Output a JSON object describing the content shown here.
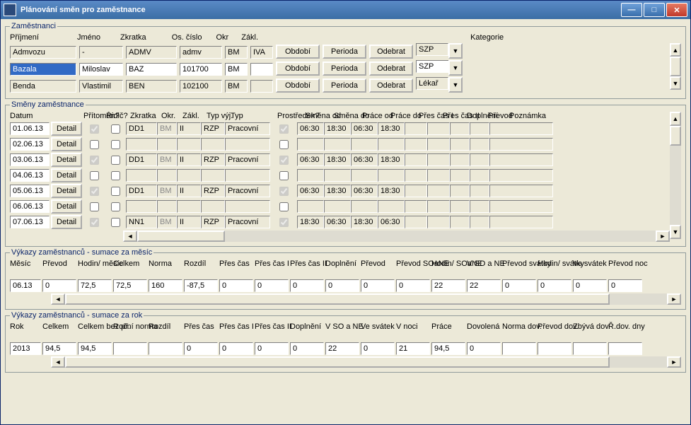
{
  "window": {
    "title": "Plánování směn pro zaměstnance"
  },
  "employees": {
    "legend": "Zaměstnanci",
    "headers": {
      "prijmeni": "Příjmení",
      "jmeno": "Jméno",
      "zkratka": "Zkratka",
      "oscislo": "Os. číslo",
      "okr": "Okr",
      "zakl": "Zákl.",
      "kategorie": "Kategorie"
    },
    "buttons": {
      "obdobi": "Období",
      "perioda": "Perioda",
      "odebrat": "Odebrat"
    },
    "rows": [
      {
        "prijmeni": "Admvozu",
        "jmeno": "-",
        "zkratka": "ADMV",
        "oscislo": "admv",
        "okr": "BM",
        "zakl": "IVA",
        "kategorie": "SZP"
      },
      {
        "prijmeni": "Bazala",
        "jmeno": "Miloslav",
        "zkratka": "BAZ",
        "oscislo": "101700",
        "okr": "BM",
        "zakl": "",
        "kategorie": "SZP"
      },
      {
        "prijmeni": "Benda",
        "jmeno": "Vlastimil",
        "zkratka": "BEN",
        "oscislo": "102100",
        "okr": "BM",
        "zakl": "",
        "kategorie": "Lékař"
      }
    ]
  },
  "shifts": {
    "legend": "Směny zaměstnance",
    "headers": {
      "datum": "Datum",
      "detail": "Detail",
      "prito_men": "Přítomen?",
      "ridic": "Řidič?",
      "zkratka": "Zkratka",
      "okr": "Okr.",
      "zakl": "Zákl.",
      "typvyj": "Typ výj.",
      "typ": "Typ",
      "prostre_dek": "Prostředek?",
      "smena_od": "Směna od",
      "smena_do": "Směna do",
      "prace_od": "Práce od",
      "prace_do": "Práce do",
      "pres_cas1": "Přes čas I",
      "pres_cas2": "Přes čas II",
      "dopl_neni": "Doplnění",
      "pre_vod": "Převod",
      "poznamka": "Poznámka"
    },
    "btn_detail": "Detail",
    "rows": [
      {
        "datum": "01.06.13",
        "p": true,
        "r": false,
        "zk": "DD1",
        "okr": "BM",
        "zakl": "II",
        "tv": "RZP",
        "typ": "Pracovní",
        "ps": true,
        "so": "06:30",
        "sd": "18:30",
        "po": "06:30",
        "pd": "18:30"
      },
      {
        "datum": "02.06.13",
        "p": false,
        "r": false,
        "zk": "",
        "okr": "",
        "zakl": "",
        "tv": "",
        "typ": "",
        "ps": false,
        "so": "",
        "sd": "",
        "po": "",
        "pd": ""
      },
      {
        "datum": "03.06.13",
        "p": true,
        "r": false,
        "zk": "DD1",
        "okr": "BM",
        "zakl": "II",
        "tv": "RZP",
        "typ": "Pracovní",
        "ps": true,
        "so": "06:30",
        "sd": "18:30",
        "po": "06:30",
        "pd": "18:30"
      },
      {
        "datum": "04.06.13",
        "p": false,
        "r": false,
        "zk": "",
        "okr": "",
        "zakl": "",
        "tv": "",
        "typ": "",
        "ps": false,
        "so": "",
        "sd": "",
        "po": "",
        "pd": ""
      },
      {
        "datum": "05.06.13",
        "p": true,
        "r": false,
        "zk": "DD1",
        "okr": "BM",
        "zakl": "II",
        "tv": "RZP",
        "typ": "Pracovní",
        "ps": true,
        "so": "06:30",
        "sd": "18:30",
        "po": "06:30",
        "pd": "18:30"
      },
      {
        "datum": "06.06.13",
        "p": false,
        "r": false,
        "zk": "",
        "okr": "",
        "zakl": "",
        "tv": "",
        "typ": "",
        "ps": false,
        "so": "",
        "sd": "",
        "po": "",
        "pd": ""
      },
      {
        "datum": "07.06.13",
        "p": true,
        "r": false,
        "zk": "NN1",
        "okr": "BM",
        "zakl": "II",
        "tv": "RZP",
        "typ": "Pracovní",
        "ps": true,
        "so": "18:30",
        "sd": "06:30",
        "po": "18:30",
        "pd": "06:30"
      }
    ]
  },
  "monthly": {
    "legend": "Výkazy zaměstnanců - sumace za měsíc",
    "labels": [
      "Měsíc",
      "Převod",
      "Hodin/ měsíc",
      "Celkem",
      "Norma",
      "Rozdíl",
      "Přes čas",
      "Přes čas I",
      "Přes čas II",
      "Doplnění",
      "Převod",
      "Převod SOaNE",
      "Hodin/ SOaNE",
      "V SO a NE",
      "Převod svátky",
      "Hodin/ svátky",
      "Ve svátek",
      "Převod noc"
    ],
    "values": [
      "06.13",
      "0",
      "72,5",
      "72,5",
      "160",
      "-87,5",
      "0",
      "0",
      "0",
      "0",
      "0",
      "0",
      "22",
      "22",
      "0",
      "0",
      "0",
      "0"
    ]
  },
  "yearly": {
    "legend": "Výkazy zaměstnanců - sumace za rok",
    "labels": [
      "Rok",
      "Celkem",
      "Celkem bez př.",
      "Roční norma",
      "Rozdíl",
      "Přes čas",
      "Přes čas I",
      "Přes čas II",
      "Doplnění",
      "V SO a NE",
      "Ve svátek",
      "V noci",
      "Práce",
      "Dovolená",
      "Norma dov.",
      "Převod dov.",
      "Zbývá dov.",
      "Ř.dov. dny"
    ],
    "values": [
      "2013",
      "94,5",
      "94,5",
      "",
      "",
      "0",
      "0",
      "0",
      "0",
      "22",
      "0",
      "21",
      "94,5",
      "0",
      "",
      "",
      "",
      ""
    ]
  }
}
